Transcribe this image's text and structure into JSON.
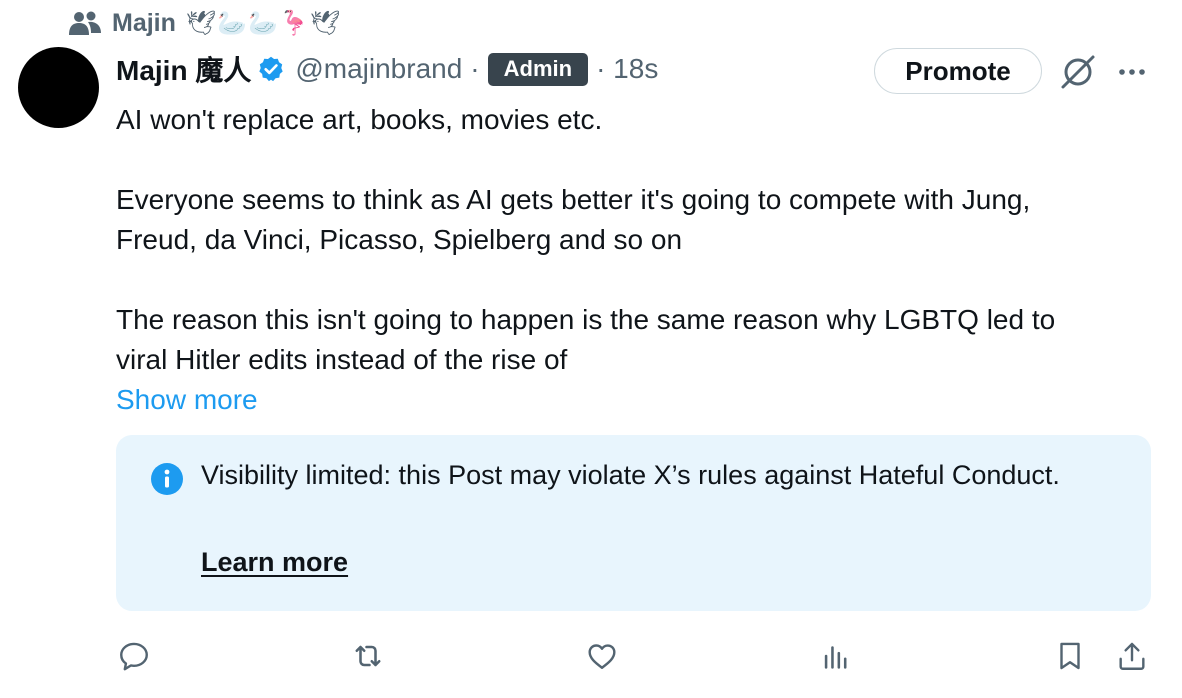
{
  "context": {
    "label": "Majin",
    "emoji": "🕊🦢🦢🦩🕊",
    "icon": "people-icon"
  },
  "post": {
    "display_name": "Majin 魔人",
    "handle": "@majinbrand",
    "separator": "·",
    "badge": "Admin",
    "timestamp": "· 18s",
    "verified_icon": "verified-badge-icon",
    "text_lines": [
      "AI won't replace art, books, movies etc.",
      "Everyone seems to think as AI gets better it's going to compete with Jung,",
      "Freud, da Vinci, Picasso, Spielberg and so on",
      "The reason this isn't going to happen is the same reason why LGBTQ led to",
      "viral Hitler edits instead of the rise of"
    ],
    "show_more": "Show more"
  },
  "header_actions": {
    "promote_label": "Promote",
    "grok_icon": "grok-icon",
    "more_icon": "more-icon"
  },
  "notice": {
    "text": "Visibility limited: this Post may violate X’s rules against Hateful Conduct.",
    "learn_more": "Learn more",
    "icon": "info-icon"
  },
  "actions": [
    "reply-icon",
    "repost-icon",
    "like-icon",
    "views-icon",
    "bookmark-icon",
    "share-icon"
  ],
  "colors": {
    "accent": "#1d9bf0",
    "secondary_text": "#536471",
    "notice_bg": "#e8f5fd",
    "badge_bg": "#38444d"
  }
}
